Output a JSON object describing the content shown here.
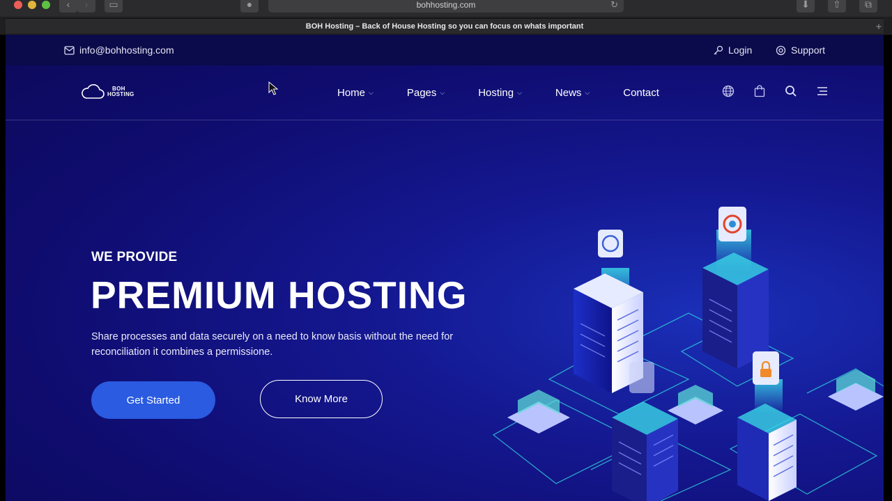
{
  "browser": {
    "url": "bohhosting.com",
    "tab_title": "BOH Hosting – Back of House Hosting so you can focus on whats important"
  },
  "topbar": {
    "email": "info@bohhosting.com",
    "login": "Login",
    "support": "Support"
  },
  "logo": {
    "line1": "BOH",
    "line2": "HOSTING"
  },
  "nav": {
    "items": [
      {
        "label": "Home",
        "dropdown": true
      },
      {
        "label": "Pages",
        "dropdown": true
      },
      {
        "label": "Hosting",
        "dropdown": true
      },
      {
        "label": "News",
        "dropdown": true
      },
      {
        "label": "Contact",
        "dropdown": false
      }
    ],
    "icons": [
      "globe-icon",
      "bag-icon",
      "search-icon",
      "menu-icon"
    ]
  },
  "hero": {
    "subtitle": "WE PROVIDE",
    "title": "PREMIUM HOSTING",
    "description": "Share processes and data securely on a need to know basis without the need for reconciliation it combines a permissione.",
    "primary_button": "Get Started",
    "secondary_button": "Know More"
  },
  "colors": {
    "background": "#14178f",
    "topbar": "#0b0a4a",
    "accent": "#2a5be0"
  }
}
